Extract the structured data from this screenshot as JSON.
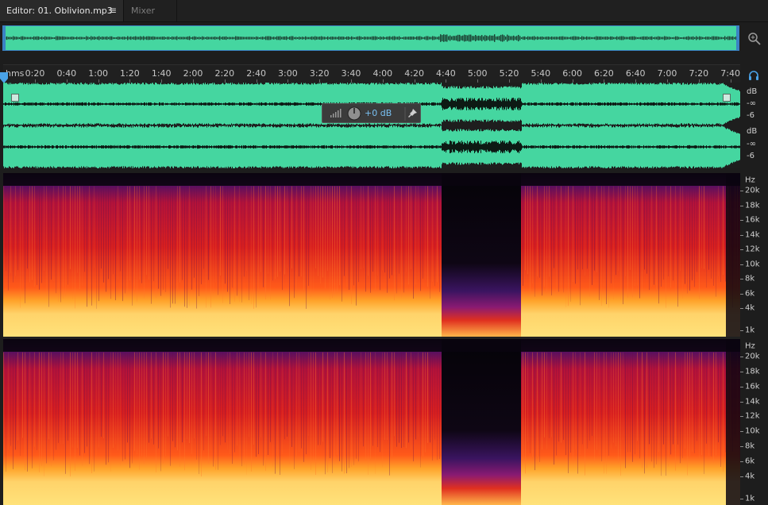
{
  "tabs": {
    "editor_label": "Editor: 01. Oblivion.mp3",
    "editor_menu_glyph": "≡",
    "mixer_label": "Mixer"
  },
  "ruler": {
    "unit_label": "hms",
    "ticks": [
      "0:20",
      "0:40",
      "1:00",
      "1:20",
      "1:40",
      "2:00",
      "2:20",
      "2:40",
      "3:00",
      "3:20",
      "3:40",
      "4:00",
      "4:20",
      "4:40",
      "5:00",
      "5:20",
      "5:40",
      "6:00",
      "6:20",
      "6:40",
      "7:00",
      "7:20",
      "7:40"
    ]
  },
  "hud": {
    "gain_value": "+0 dB"
  },
  "amplitude_scale": {
    "top_channel": [
      "dB",
      "-∞",
      "-6"
    ],
    "bottom_channel": [
      "dB",
      "-∞",
      "-6"
    ]
  },
  "frequency_scale": {
    "unit": "Hz",
    "labels": [
      "20k",
      "18k",
      "16k",
      "14k",
      "12k",
      "10k",
      "8k",
      "6k",
      "4k",
      "1k"
    ]
  },
  "colors": {
    "waveform": "#45d6a0",
    "selection_border": "#3b82c4",
    "accent_blue": "#79c0f2",
    "spectro_low": "#ffd36a",
    "spectro_mid": "#ff5a1a",
    "spectro_high": "#b3123a",
    "spectro_top": "#5a1060",
    "spectro_quiet": "#120818"
  },
  "icons": [
    "menu-icon",
    "zoom-icon",
    "playhead-icon",
    "headphone-icon",
    "level-bars-icon",
    "gain-knob-icon",
    "pin-icon",
    "fade-in-handle-icon",
    "fade-out-handle-icon",
    "resize-grip-icon"
  ]
}
